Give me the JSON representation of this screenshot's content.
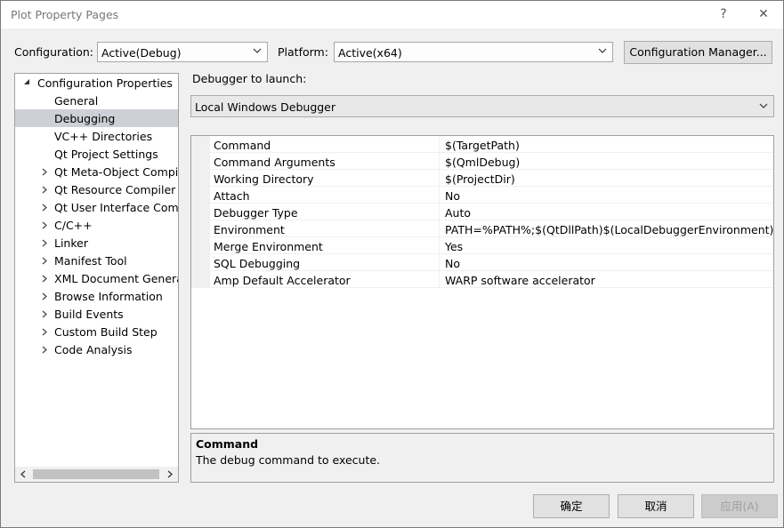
{
  "window": {
    "title": "Plot Property Pages",
    "help_label": "?",
    "close_label": "✕"
  },
  "config": {
    "configuration_label": "Configuration:",
    "configuration_value": "Active(Debug)",
    "platform_label": "Platform:",
    "platform_value": "Active(x64)",
    "manager_label": "Configuration Manager..."
  },
  "tree": {
    "root": "Configuration Properties",
    "items": [
      {
        "label": "General"
      },
      {
        "label": "Debugging"
      },
      {
        "label": "VC++ Directories"
      },
      {
        "label": "Qt Project Settings"
      },
      {
        "label": "Qt Meta-Object Compile"
      },
      {
        "label": "Qt Resource Compiler"
      },
      {
        "label": "Qt User Interface Comp"
      },
      {
        "label": "C/C++"
      },
      {
        "label": "Linker"
      },
      {
        "label": "Manifest Tool"
      },
      {
        "label": "XML Document Generat"
      },
      {
        "label": "Browse Information"
      },
      {
        "label": "Build Events"
      },
      {
        "label": "Custom Build Step"
      },
      {
        "label": "Code Analysis"
      }
    ]
  },
  "debugger": {
    "launch_label": "Debugger to launch:",
    "launch_value": "Local Windows Debugger"
  },
  "properties": [
    {
      "name": "Command",
      "value": "$(TargetPath)"
    },
    {
      "name": "Command Arguments",
      "value": "$(QmlDebug)"
    },
    {
      "name": "Working Directory",
      "value": "$(ProjectDir)"
    },
    {
      "name": "Attach",
      "value": "No"
    },
    {
      "name": "Debugger Type",
      "value": "Auto"
    },
    {
      "name": "Environment",
      "value": "PATH=%PATH%;$(QtDllPath)$(LocalDebuggerEnvironment)"
    },
    {
      "name": "Merge Environment",
      "value": "Yes"
    },
    {
      "name": "SQL Debugging",
      "value": "No"
    },
    {
      "name": "Amp Default Accelerator",
      "value": "WARP software accelerator"
    }
  ],
  "description": {
    "title": "Command",
    "text": "The debug command to execute."
  },
  "buttons": {
    "ok": "确定",
    "cancel": "取消",
    "apply": "应用(A)"
  }
}
